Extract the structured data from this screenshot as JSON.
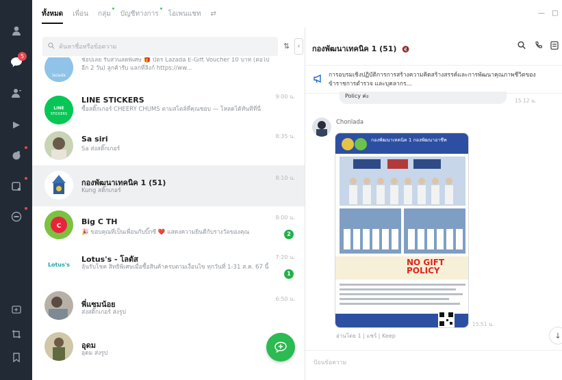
{
  "tabs": [
    {
      "label": "ทั้งหมด",
      "active": true,
      "dot": false
    },
    {
      "label": "เพื่อน",
      "active": false,
      "dot": false
    },
    {
      "label": "กลุ่ม",
      "active": false,
      "dot": true
    },
    {
      "label": "บัญชีทางการ",
      "active": false,
      "dot": true
    },
    {
      "label": "โอเพนแชท",
      "active": false,
      "dot": false
    }
  ],
  "search": {
    "placeholder": "ค้นหาชื่อหรือข้อความ"
  },
  "rail": {
    "chats_badge": "5"
  },
  "chats": [
    {
      "name": "",
      "message": "ช้อปเลย รับส่วนลดพิเศษ 🎁 บัตร Lazada E-Gift Voucher 10 บาท (ต่อไปอีก 2 วัน) ลูกค้ารับ แลกที่ลิงก์ https://ww...",
      "time": "",
      "unread": ""
    },
    {
      "name": "LINE STICKERS",
      "message": "ซื้อสติ๊กเกอร์ CHEERY CHUMS ตามสไตล์ที่คุณชอบ — โหลดได้ทันทีที่นี่",
      "time": "9:00 น.",
      "unread": ""
    },
    {
      "name": "Sa siri",
      "message": "Sa ส่งสติ๊กเกอร์",
      "time": "8:35 น.",
      "unread": ""
    },
    {
      "name": "กองพัฒนาเทคนิค 1 (51)",
      "message": "Kung สติ๊กเกอร์",
      "time": "8:10 น.",
      "unread": ""
    },
    {
      "name": "Big C TH",
      "message": "🎉 ขอบคุณที่เป็นเพื่อนกับบิ๊กซี ❤️ แสดงความยินดีกับรางวัลของคุณ",
      "time": "8:00 น.",
      "unread": "2"
    },
    {
      "name": "Lotus's - โลตัส",
      "message": "ลุ้นรับโชค สิทธิพิเศษเมื่อซื้อสินค้าครบตามเงื่อนไข ทุกวันที่ 1-31 ส.ค. 67 นี้",
      "time": "7:20 น.",
      "unread": "1"
    },
    {
      "name": "พี่แซมน้อย",
      "message": "ส่งสติ๊กเกอร์ ส่งรูป",
      "time": "6:50 น.",
      "unread": ""
    },
    {
      "name": "อุดม",
      "message": "อุดม ส่งรูป",
      "time": "",
      "unread": ""
    }
  ],
  "chat": {
    "title": "กองพัฒนาเทคนิค 1 (51)",
    "announcement": "การอบรมเชิงปฏิบัติการการสร้างความคิดสร้างสรรค์และการพัฒนาคุณภาพชีวิตของข้าราชการตำรวจ และบุคลากร...",
    "prev_bubble": "Policy ค่ะ",
    "prev_time": "15.12 น.",
    "sender": "Chonlada",
    "poster_title": "กองพัฒนาเทคนิค 1 กองพัฒนาอาชีพ",
    "poster_no_gift": "NO GIFT POLICY",
    "img_time": "15.51 น.",
    "img_caption": "อ่านโดย 1 | แชร์ | Keep",
    "composer_placeholder": "ป้อนข้อความ"
  },
  "colors": {
    "rail": "#222a35",
    "accent": "#2cba52",
    "badge": "#e8454f",
    "link": "#1f66d1"
  }
}
